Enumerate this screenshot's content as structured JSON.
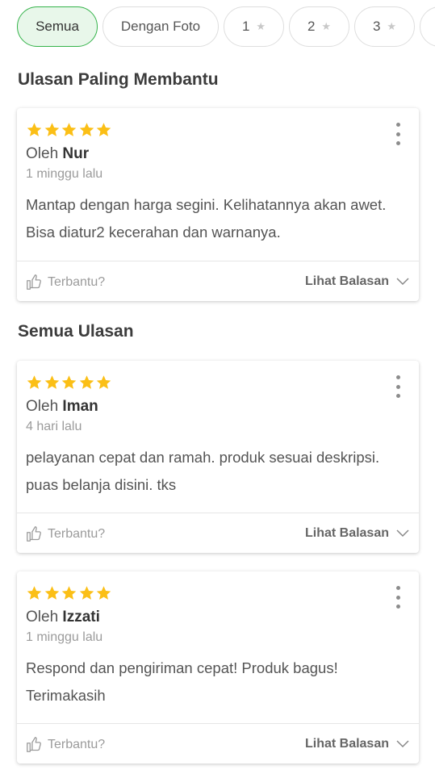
{
  "filters": [
    {
      "label": "Semua",
      "active": true,
      "star": false
    },
    {
      "label": "Dengan Foto",
      "active": false,
      "star": false
    },
    {
      "label": "1",
      "active": false,
      "star": true
    },
    {
      "label": "2",
      "active": false,
      "star": true
    },
    {
      "label": "3",
      "active": false,
      "star": true
    },
    {
      "label": "",
      "active": false,
      "star": false
    }
  ],
  "sections": {
    "most_helpful": "Ulasan Paling Membantu",
    "all_reviews": "Semua Ulasan"
  },
  "reviews": [
    {
      "rating": 5,
      "by": "Oleh",
      "name": "Nur",
      "time": "1 minggu lalu",
      "text": "Mantap dengan harga segini. Kelihatannya akan awet. Bisa diatur2 kecerahan dan warnanya.",
      "helpful": "Terbantu?",
      "replies": "Lihat Balasan"
    },
    {
      "rating": 5,
      "by": "Oleh",
      "name": "Iman",
      "time": "4 hari lalu",
      "text": "pelayanan cepat dan ramah. produk sesuai deskripsi. puas belanja disini. tks",
      "helpful": "Terbantu?",
      "replies": "Lihat Balasan"
    },
    {
      "rating": 5,
      "by": "Oleh",
      "name": "Izzati",
      "time": "1 minggu lalu",
      "text": "Respond dan pengiriman cepat! Produk bagus! Terimakasih",
      "helpful": "Terbantu?",
      "replies": "Lihat Balasan"
    }
  ],
  "icons": {
    "star": "star-icon",
    "helpful": "thumbs-up-icon",
    "more": "more-vertical-icon",
    "expand": "chevron-down-icon"
  },
  "colors": {
    "accent": "#34b34a",
    "star": "#fbbf16"
  }
}
